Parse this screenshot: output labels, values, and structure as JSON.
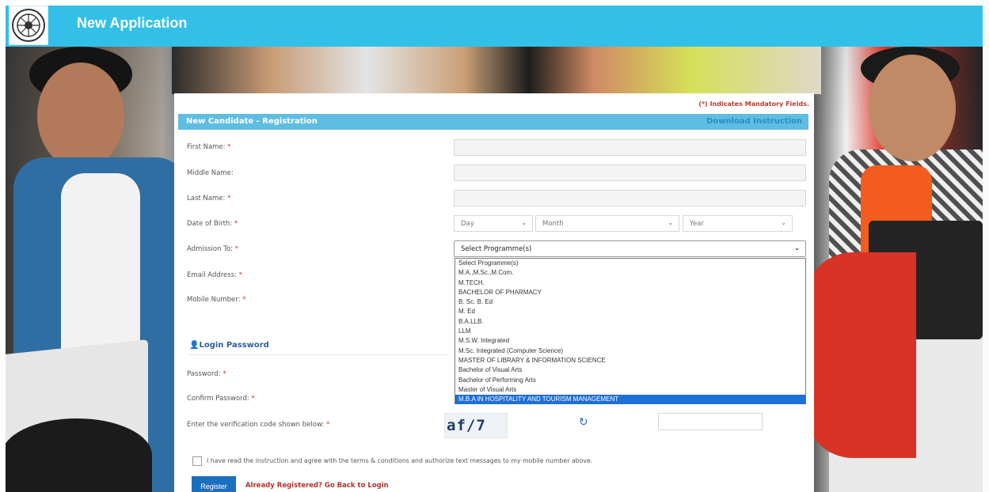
{
  "app": {
    "title": "New Application"
  },
  "form": {
    "mandatory_note": "(*) Indicates Mandatory Fields.",
    "section_title": "New Candidate - Registration",
    "download_link": "Download Instruction",
    "required_mark": "*",
    "fields": {
      "first_name": "First Name:",
      "middle_name": "Middle Name:",
      "last_name": "Last Name:",
      "dob": "Date of Birth:",
      "admission": "Admission To:",
      "email": "Email Address:",
      "mobile": "Mobile Number:",
      "password": "Password:",
      "confirm_password": "Confirm Password:",
      "verification": "Enter the verification code shown below:"
    },
    "dob": {
      "day": "Day",
      "month": "Month",
      "year": "Year"
    },
    "admission_select": {
      "value": "Select Programme(s)",
      "options": [
        "Select Programme(s)",
        "M.A.,M.Sc.,M.Com.",
        "M.TECH.",
        "BACHELOR OF PHARMACY",
        "B. Sc. B. Ed",
        "M. Ed",
        "B.A.LLB.",
        "LLM",
        "M.S.W. Integrated",
        "M.Sc. Integrated (Computer Science)",
        "MASTER OF LIBRARY & INFORMATION SCIENCE",
        "Bachelor of Visual Arts",
        "Bachelor of Performing Arts",
        "Master of Visual Arts",
        "M.B.A IN HOSPITALITY AND TOURISM MANAGEMENT"
      ],
      "highlighted_index": 14
    },
    "login_section": "Login Password",
    "captcha_text": "af/7",
    "agree_text": "I have read the instruction and agree with the terms & conditions and authorize text messages to my mobile number above.",
    "register_label": "Register",
    "back_to_login": "Already Registered? Go Back to Login"
  },
  "icons": {
    "user": "user-icon",
    "refresh": "refresh-icon",
    "chevron": "chevron-down-icon"
  },
  "colors": {
    "topbar": "#33c0e8",
    "section": "#5fbde2",
    "primary_button": "#1b6fc0",
    "required": "#d0312d",
    "highlight": "#1e6fd6"
  }
}
